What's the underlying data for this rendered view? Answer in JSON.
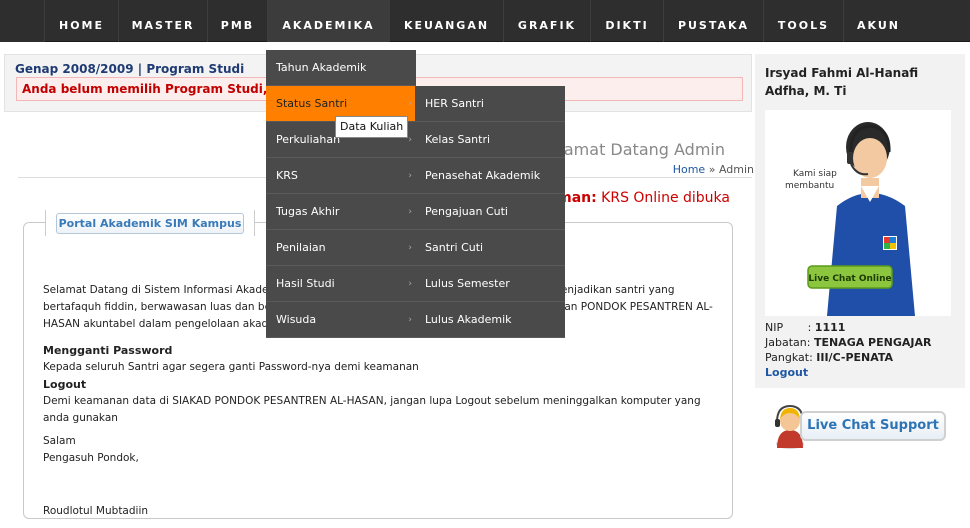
{
  "nav": {
    "items": [
      {
        "label": "HOME"
      },
      {
        "label": "MASTER"
      },
      {
        "label": "PMB"
      },
      {
        "label": "AKADEMIKA"
      },
      {
        "label": "KEUANGAN"
      },
      {
        "label": "GRAFIK"
      },
      {
        "label": "DIKTI"
      },
      {
        "label": "PUSTAKA"
      },
      {
        "label": "TOOLS"
      },
      {
        "label": "AKUN"
      }
    ]
  },
  "infobar": {
    "semester": "Genap 2008/2009 | Program Studi",
    "warning": "Anda belum memilih Program Studi, Klik"
  },
  "welcome": "Selamat Datang Admin",
  "breadcrumb": {
    "home": "Home",
    "sep": "»",
    "current": "Admin"
  },
  "announcement": {
    "label": "umuman:",
    "text": "KRS Online dibuka"
  },
  "portal": {
    "tab_label": "Portal Akademik SIM Kampus"
  },
  "content": {
    "intro": "Selamat Datang di Sistem Informasi Akademik (SIAKAD) PONDOK PESANTREN AL-HASAN, untuk menjadikan santri yang bertafaquh fiddin, berwawasan luas dan berakhlakul karimah. Semoga dengan sistem ini, diharapkan PONDOK PESANTREN AL-HASAN akuntabel dalam pengelolaan akademik santri.",
    "h_password": "Mengganti Password",
    "t_password": "Kepada seluruh Santri agar segera ganti Password-nya demi keamanan",
    "h_logout": "Logout",
    "t_logout": "Demi keamanan data di SIAKAD PONDOK PESANTREN AL-HASAN, jangan lupa Logout sebelum meninggalkan komputer yang anda gunakan",
    "salam": "Salam",
    "pengasuh": "Pengasuh Pondok,",
    "signature": "Roudlotul Mubtadiin"
  },
  "user": {
    "name": "Irsyad Fahmi Al-Hanafi Adfha, M. Ti",
    "photo_caption": "Kami siap membantu",
    "photo_button": "Live Chat Online",
    "nip_label": "NIP",
    "nip_value": "1111",
    "jabatan_label": "Jabatan:",
    "jabatan_value": "TENAGA PENGAJAR",
    "pangkat_label": "Pangkat:",
    "pangkat_value": "III/C-PENATA",
    "logout": "Logout"
  },
  "chat_support": {
    "label": "Live Chat Support"
  },
  "akademika_menu": [
    {
      "label": "Tahun Akademik",
      "submenu": false
    },
    {
      "label": "Status Santri",
      "submenu": true
    },
    {
      "label": "Perkuliahan",
      "submenu": true
    },
    {
      "label": "KRS",
      "submenu": true
    },
    {
      "label": "Tugas Akhir",
      "submenu": true
    },
    {
      "label": "Penilaian",
      "submenu": true
    },
    {
      "label": "Hasil Studi",
      "submenu": true
    },
    {
      "label": "Wisuda",
      "submenu": true
    }
  ],
  "status_submenu": [
    {
      "label": "HER Santri"
    },
    {
      "label": "Kelas Santri"
    },
    {
      "label": "Penasehat Akademik"
    },
    {
      "label": "Pengajuan Cuti"
    },
    {
      "label": "Santri Cuti"
    },
    {
      "label": "Lulus Semester"
    },
    {
      "label": "Lulus Akademik"
    }
  ],
  "tooltip": "Data Kuliah",
  "colors": {
    "nav_bg": "#2e2e2e",
    "menu_bg": "#4a4a4a",
    "highlight": "#ff8000",
    "warning": "#c20000",
    "link": "#1f57a4"
  }
}
